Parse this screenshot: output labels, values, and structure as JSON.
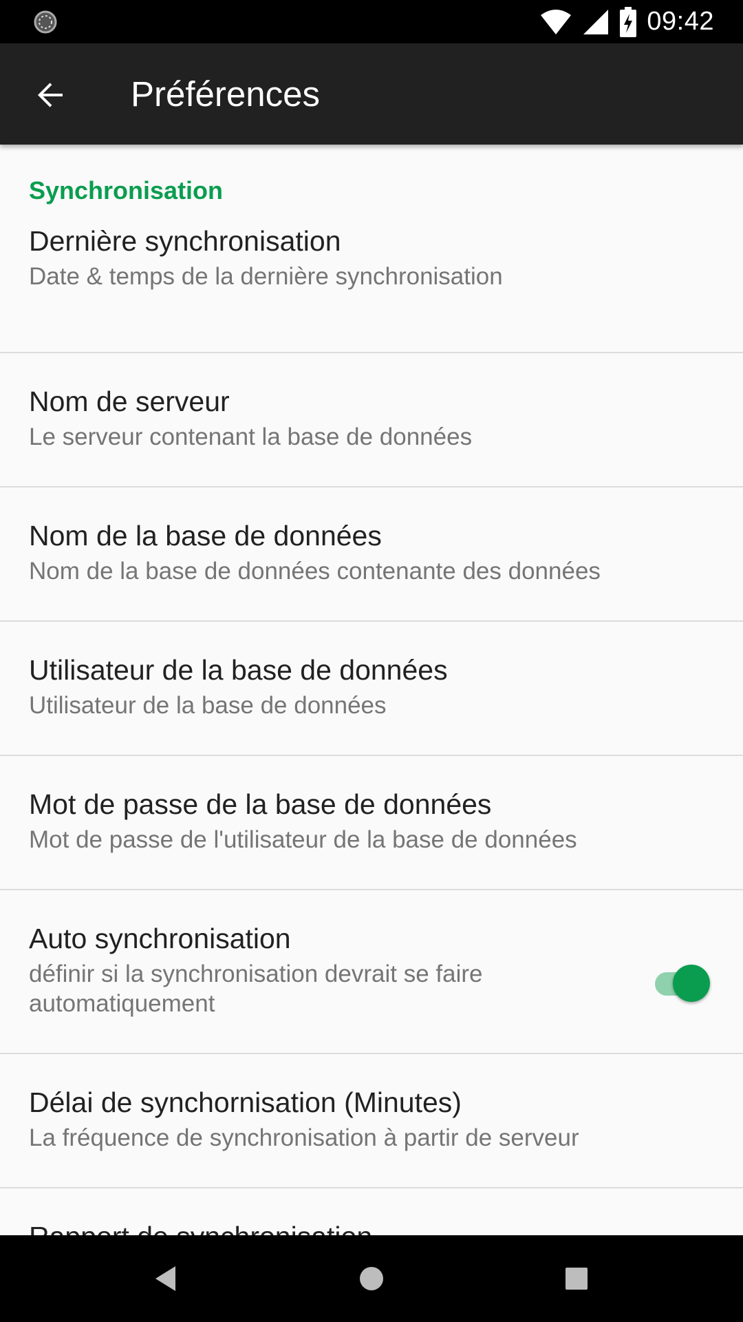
{
  "status_bar": {
    "time": "09:42",
    "left_icon": "loading-circle-icon",
    "icons": [
      "wifi-icon",
      "signal-icon",
      "battery-charging-icon"
    ]
  },
  "app_bar": {
    "back_icon": "arrow-back-icon",
    "title": "Préférences"
  },
  "accent_color": "#0a9d4f",
  "category": {
    "label": "Synchronisation"
  },
  "preferences": [
    {
      "title": "Dernière synchronisation",
      "summary": "Date & temps de la dernière synchronisation"
    },
    {
      "title": "Nom de serveur",
      "summary": "Le serveur contenant la base de données"
    },
    {
      "title": "Nom de la base de données",
      "summary": "Nom de la base de données contenante des données"
    },
    {
      "title": "Utilisateur de la base de données",
      "summary": "Utilisateur de la base de données"
    },
    {
      "title": "Mot de passe de la base de données",
      "summary": "Mot de passe de l'utilisateur de la base de données"
    },
    {
      "title": "Auto synchronisation",
      "summary": "définir si la synchronisation devrait se faire automatiquement",
      "toggle_on": true
    },
    {
      "title": "Délai de synchornisation (Minutes)",
      "summary": "La fréquence de synchronisation à partir de serveur"
    },
    {
      "title": "Rapport de synchronisation",
      "summary": ""
    }
  ],
  "nav_bar": {
    "buttons": [
      "back-triangle-icon",
      "home-circle-icon",
      "recents-square-icon"
    ]
  }
}
